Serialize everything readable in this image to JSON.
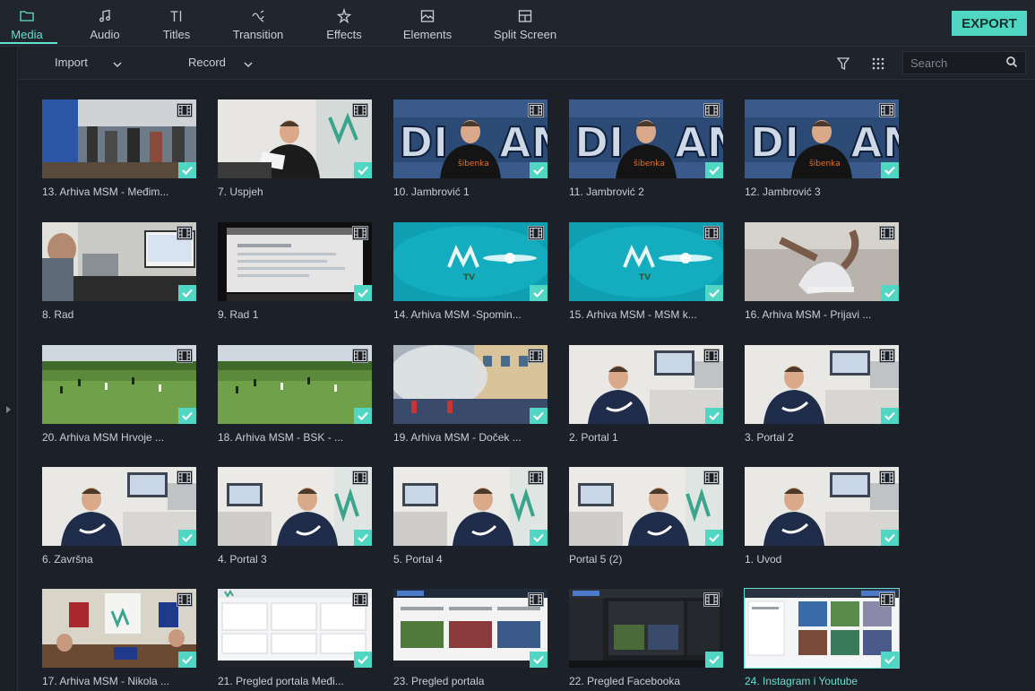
{
  "tabs": [
    {
      "label": "Media",
      "icon": "folder-icon",
      "active": true
    },
    {
      "label": "Audio",
      "icon": "music-note-icon",
      "active": false
    },
    {
      "label": "Titles",
      "icon": "text-cursor-icon",
      "active": false
    },
    {
      "label": "Transition",
      "icon": "transition-icon",
      "active": false
    },
    {
      "label": "Effects",
      "icon": "sparkle-icon",
      "active": false
    },
    {
      "label": "Elements",
      "icon": "image-icon",
      "active": false
    },
    {
      "label": "Split Screen",
      "icon": "split-screen-icon",
      "active": false
    }
  ],
  "export_label": "EXPORT",
  "toolbar": {
    "import_label": "Import",
    "record_label": "Record",
    "search_placeholder": "Search"
  },
  "colors": {
    "accent": "#63e0d0",
    "export_bg": "#4fd7c3",
    "background": "#1c2129"
  },
  "clips": [
    {
      "name": "13. Arhiva MSM - Međim...",
      "scene": "crowd"
    },
    {
      "name": "7. Uspjeh",
      "scene": "office-man"
    },
    {
      "name": "10. Jambrović 1",
      "scene": "graffiti-man"
    },
    {
      "name": "11. Jambrović 2",
      "scene": "graffiti-man"
    },
    {
      "name": "12. Jambrović 3",
      "scene": "graffiti-man"
    },
    {
      "name": "8. Rad",
      "scene": "desk-laptop"
    },
    {
      "name": "9. Rad 1",
      "scene": "screen"
    },
    {
      "name": "14. Arhiva MSM -Spomin...",
      "scene": "teal-logo"
    },
    {
      "name": "15. Arhiva MSM - MSM k...",
      "scene": "teal-logo"
    },
    {
      "name": "16. Arhiva MSM - Prijavi ...",
      "scene": "shoes"
    },
    {
      "name": "20. Arhiva MSM Hrvoje ...",
      "scene": "field"
    },
    {
      "name": "18. Arhiva MSM - BSK - ...",
      "scene": "field"
    },
    {
      "name": "19. Arhiva MSM - Doček ...",
      "scene": "smoke"
    },
    {
      "name": "2. Portal 1",
      "scene": "nike-man"
    },
    {
      "name": "3. Portal 2",
      "scene": "nike-man"
    },
    {
      "name": "6. Završna",
      "scene": "nike-man"
    },
    {
      "name": "4. Portal 3",
      "scene": "nike-man-logo"
    },
    {
      "name": "5. Portal 4",
      "scene": "nike-man-logo"
    },
    {
      "name": "Portal 5 (2)",
      "scene": "nike-man-logo"
    },
    {
      "name": "1. Uvod",
      "scene": "nike-man"
    },
    {
      "name": "17. Arhiva MSM - Nikola ...",
      "scene": "room-jerseys"
    },
    {
      "name": "21. Pregled portala Međi...",
      "scene": "webpage-light"
    },
    {
      "name": "23. Pregled portala",
      "scene": "webpage-photos"
    },
    {
      "name": "22. Pregled Facebooka",
      "scene": "webpage-dark"
    },
    {
      "name": "24. Instagram i Youtube",
      "scene": "webpage-grid",
      "selected": true
    }
  ]
}
